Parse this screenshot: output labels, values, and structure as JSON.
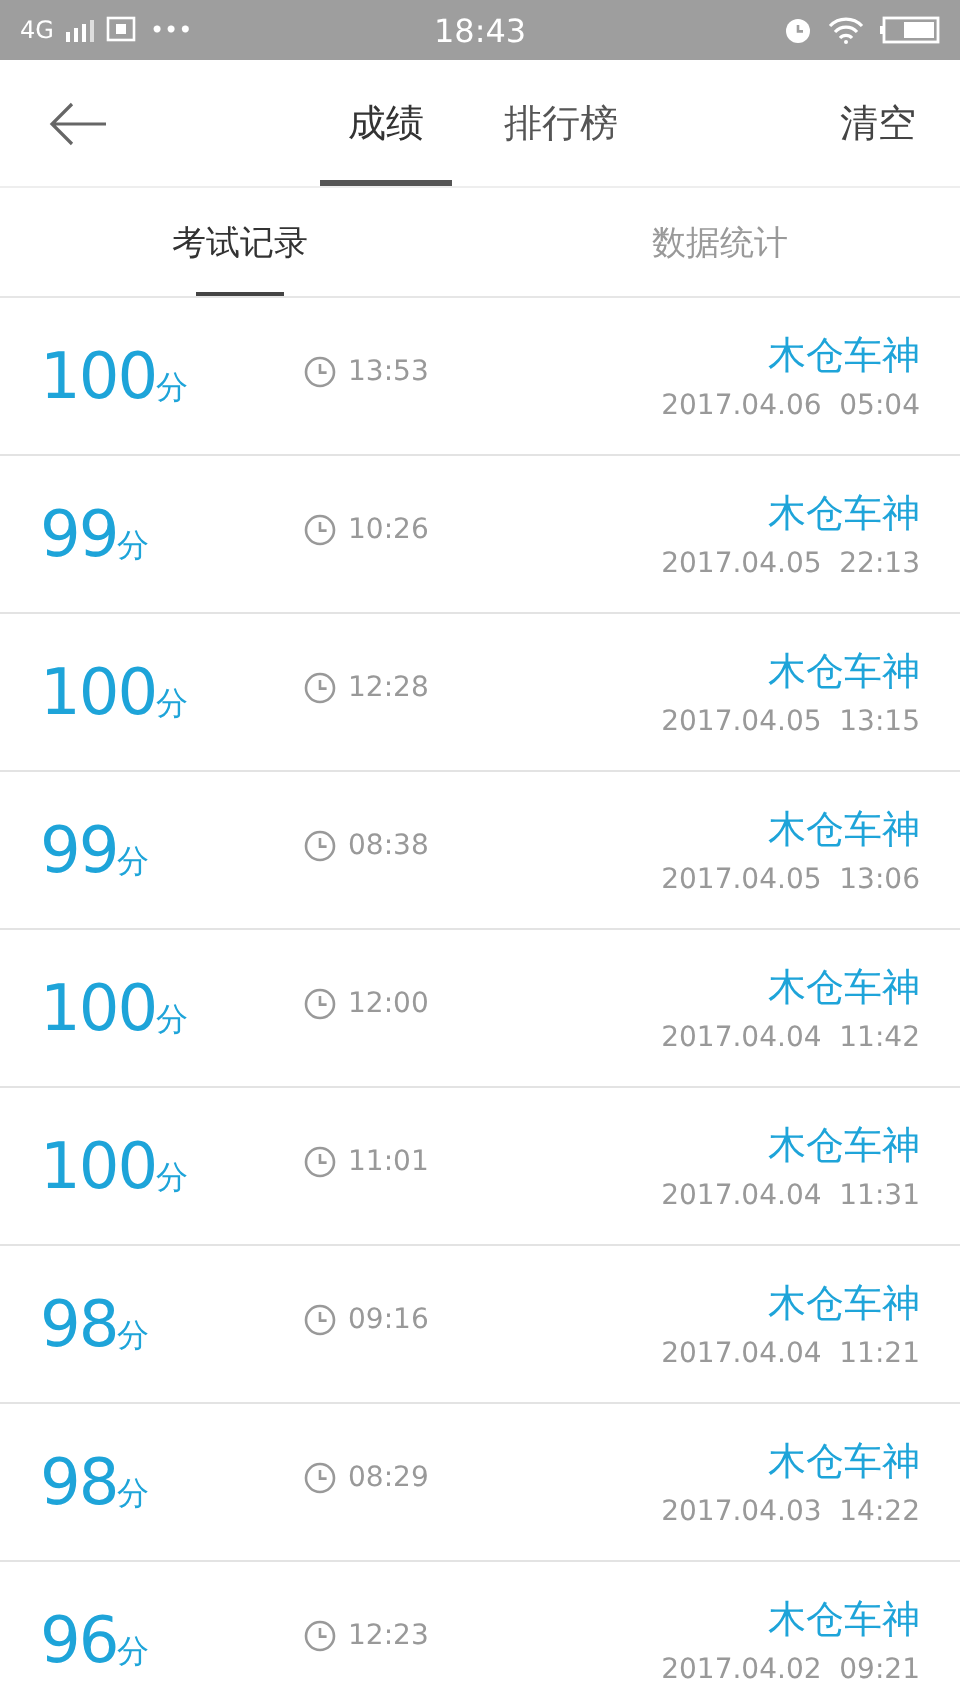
{
  "status_bar": {
    "network": "4G",
    "more": "•••",
    "time": "18:43"
  },
  "header": {
    "tabs": [
      {
        "label": "成绩",
        "selected": true
      },
      {
        "label": "排行榜",
        "selected": false
      }
    ],
    "action": "清空"
  },
  "sub_tabs": [
    {
      "label": "考试记录",
      "selected": true
    },
    {
      "label": "数据统计",
      "selected": false
    }
  ],
  "records": [
    {
      "score": "100",
      "unit": "分",
      "duration": "13:53",
      "name": "木仓车神",
      "datetime": "2017.04.06  05:04"
    },
    {
      "score": "99",
      "unit": "分",
      "duration": "10:26",
      "name": "木仓车神",
      "datetime": "2017.04.05  22:13"
    },
    {
      "score": "100",
      "unit": "分",
      "duration": "12:28",
      "name": "木仓车神",
      "datetime": "2017.04.05  13:15"
    },
    {
      "score": "99",
      "unit": "分",
      "duration": "08:38",
      "name": "木仓车神",
      "datetime": "2017.04.05  13:06"
    },
    {
      "score": "100",
      "unit": "分",
      "duration": "12:00",
      "name": "木仓车神",
      "datetime": "2017.04.04  11:42"
    },
    {
      "score": "100",
      "unit": "分",
      "duration": "11:01",
      "name": "木仓车神",
      "datetime": "2017.04.04  11:31"
    },
    {
      "score": "98",
      "unit": "分",
      "duration": "09:16",
      "name": "木仓车神",
      "datetime": "2017.04.04  11:21"
    },
    {
      "score": "98",
      "unit": "分",
      "duration": "08:29",
      "name": "木仓车神",
      "datetime": "2017.04.03  14:22"
    },
    {
      "score": "96",
      "unit": "分",
      "duration": "12:23",
      "name": "木仓车神",
      "datetime": "2017.04.02  09:21"
    }
  ]
}
